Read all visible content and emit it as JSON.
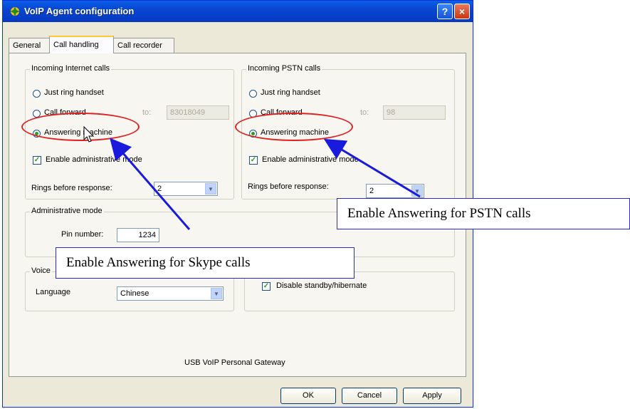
{
  "window": {
    "title": "VoIP Agent configuration",
    "help_glyph": "?",
    "close_glyph": "×"
  },
  "tabs": [
    "General",
    "Call handling",
    "Call recorder"
  ],
  "internet": {
    "legend": "Incoming Internet calls",
    "just_ring": "Just ring handset",
    "call_forward": "Call forward",
    "to_label": "to:",
    "forward_number": "83018049",
    "answering_machine": "Answering machine",
    "selected": "Answering machine",
    "enable_admin": "Enable administrative mode",
    "enable_admin_checked": true,
    "rings_label": "Rings before response:",
    "rings_value": "2"
  },
  "pstn": {
    "legend": "Incoming PSTN calls",
    "just_ring": "Just ring handset",
    "call_forward": "Call forward",
    "to_label": "to:",
    "forward_number": "98",
    "answering_machine": "Answering machine",
    "selected": "Answering machine",
    "enable_admin": "Enable administrative mode",
    "enable_admin_checked": true,
    "rings_label": "Rings before response:",
    "rings_value": "2"
  },
  "admin": {
    "legend": "Administrative mode",
    "pin_label": "Pin number:",
    "pin_value": "1234"
  },
  "voice": {
    "legend": "Voice",
    "language_label": "Language",
    "language_value": "Chinese"
  },
  "misc": {
    "disable_standby": "Disable standby/hibernate",
    "disable_standby_checked": true
  },
  "footer_text": "USB VoIP Personal Gateway",
  "buttons": {
    "ok": "OK",
    "cancel": "Cancel",
    "apply": "Apply"
  },
  "annotations": {
    "pstn_callout": "Enable Answering for PSTN calls",
    "skype_callout": "Enable Answering for Skype calls",
    "arrow_color": "#1a1adc",
    "ellipse_color": "#e02020"
  },
  "colors": {
    "titlebar": "#0846d3",
    "dialog_bg": "#ece9d8",
    "tab_accent": "#ffc83c"
  }
}
